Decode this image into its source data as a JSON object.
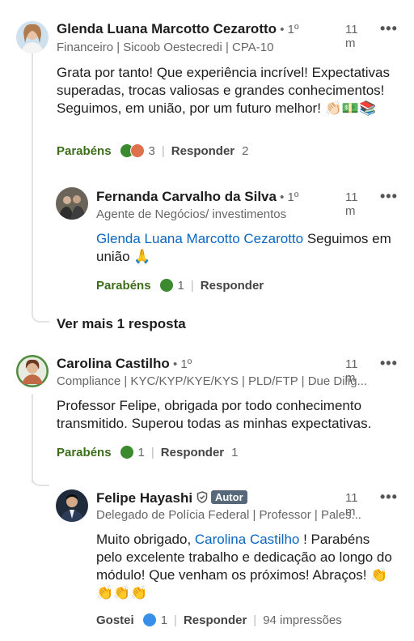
{
  "comments": [
    {
      "name": "Glenda Luana Marcotto Cezarotto",
      "degree": " • 1º",
      "time": "11 m",
      "headline": "Financeiro | Sicoob Oestecredi | CPA-10",
      "body": "Grata por tanto! Que experiência incrível! Expectativas superadas, trocas valiosas e grandes conhecimentos! Seguimos, em união, por um futuro melhor! 👏🏻💵📚",
      "like_label": "Parabéns",
      "reaction_count": "3",
      "reply_label": "Responder",
      "reply_count": "2"
    },
    {
      "name": "Fernanda Carvalho da Silva",
      "degree": " • 1º",
      "time": "11 m",
      "headline": "Agente de Negócios/ investimentos",
      "mention": "Glenda Luana Marcotto Cezarotto",
      "body": " Seguimos em união 🙏",
      "like_label": "Parabéns",
      "reaction_count": "1",
      "reply_label": "Responder"
    },
    {
      "name": "Carolina Castilho",
      "degree": " • 1º",
      "time": "11 m",
      "headline": "Compliance | KYC/KYP/KYE/KYS | PLD/FTP | Due Dilig...",
      "body": "Professor Felipe, obrigada por todo conhecimento transmitido. Superou todas as minhas expectativas.",
      "like_label": "Parabéns",
      "reaction_count": "1",
      "reply_label": "Responder",
      "reply_count": "1"
    },
    {
      "name": "Felipe Hayashi",
      "badge": "Autor",
      "time": "11 m",
      "headline": "Delegado de Polícia Federal | Professor | Pales...",
      "body_prefix": "Muito obrigado, ",
      "mention": "Carolina Castilho",
      "body": " ! Parabéns pelo excelente trabalho e dedicação ao longo do módulo! Que venham os próximos! Abraços! 👏👏👏👏",
      "like_label": "Gostei",
      "reaction_count": "1",
      "reply_label": "Responder",
      "impressions": "94 impressões"
    }
  ],
  "see_more_label": "Ver mais 1 resposta",
  "more_icon": "•••",
  "colors": {
    "mention": "#0a66c2",
    "celebrate": "#3c6e1a",
    "author_badge": "#56687a"
  },
  "icons": [
    "more-options-icon",
    "celebrate-reaction-icon",
    "love-reaction-icon",
    "like-reaction-icon",
    "shield-verified-icon"
  ]
}
